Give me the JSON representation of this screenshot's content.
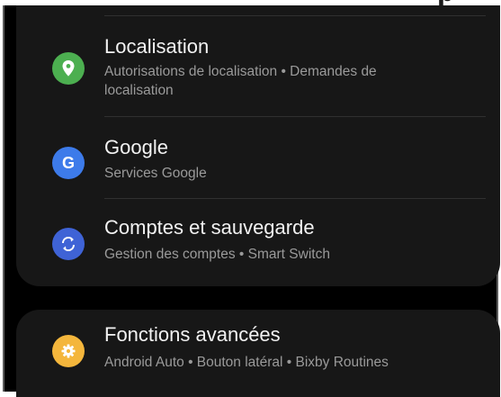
{
  "settings": {
    "items": [
      {
        "title": "Localisation",
        "subtitle": "Autorisations de localisation • Demandes de localisation",
        "icon": "location-pin-icon",
        "color": "#4CAF50"
      },
      {
        "title": "Google",
        "subtitle": "Services Google",
        "icon": "google-g-icon",
        "color": "#3D7BEA"
      },
      {
        "title": "Comptes et sauvegarde",
        "subtitle": "Gestion des comptes • Smart Switch",
        "icon": "sync-icon",
        "color": "#3F63D6"
      },
      {
        "title": "Fonctions avancées",
        "subtitle": "Android Auto • Bouton latéral • Bixby Routines",
        "icon": "gear-icon",
        "color": "#F4B63C"
      }
    ]
  }
}
